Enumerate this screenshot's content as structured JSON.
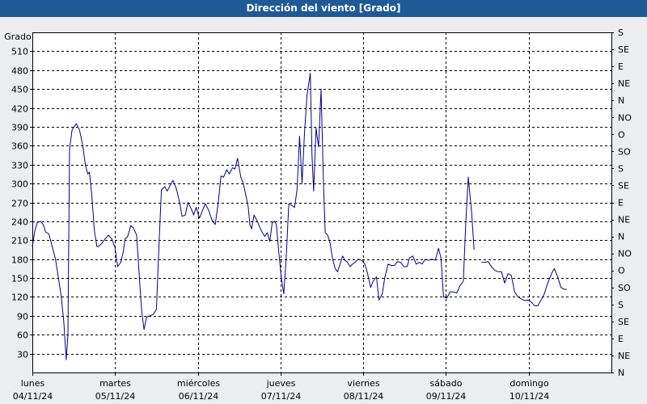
{
  "title": "Dirección del viento [Grado]",
  "chart_data": {
    "type": "line",
    "title": "Dirección del viento [Grado]",
    "ylabel": "Grado",
    "ylim": [
      0,
      540
    ],
    "yticks": [
      30,
      60,
      90,
      120,
      150,
      180,
      210,
      240,
      270,
      300,
      330,
      360,
      390,
      420,
      450,
      480,
      510
    ],
    "xlim": [
      0,
      7
    ],
    "xlabel": "",
    "x_ticks": [
      {
        "x": 0,
        "day": "lunes",
        "date": "04/11/24"
      },
      {
        "x": 1,
        "day": "martes",
        "date": "05/11/24"
      },
      {
        "x": 2,
        "day": "miércoles",
        "date": "06/11/24"
      },
      {
        "x": 3,
        "day": "jueves",
        "date": "07/11/24"
      },
      {
        "x": 4,
        "day": "viernes",
        "date": "08/11/24"
      },
      {
        "x": 5,
        "day": "sábado",
        "date": "09/11/24"
      },
      {
        "x": 6,
        "day": "domingo",
        "date": "10/11/24"
      }
    ],
    "right_axis": [
      {
        "value": 0,
        "label": "N"
      },
      {
        "value": 30,
        "label": "NE"
      },
      {
        "value": 60,
        "label": "E"
      },
      {
        "value": 90,
        "label": "SE"
      },
      {
        "value": 120,
        "label": "S"
      },
      {
        "value": 150,
        "label": "SO"
      },
      {
        "value": 180,
        "label": "O"
      },
      {
        "value": 210,
        "label": "NO"
      },
      {
        "value": 240,
        "label": "N"
      },
      {
        "value": 270,
        "label": "NE"
      },
      {
        "value": 300,
        "label": "E"
      },
      {
        "value": 330,
        "label": "SE"
      },
      {
        "value": 360,
        "label": "S"
      },
      {
        "value": 390,
        "label": "SO"
      },
      {
        "value": 420,
        "label": "O"
      },
      {
        "value": 450,
        "label": "NO"
      },
      {
        "value": 480,
        "label": "N"
      },
      {
        "value": 510,
        "label": "NE"
      },
      {
        "value": 540,
        "label": "E"
      },
      {
        "value": 570,
        "label": "SE"
      },
      {
        "value": 600,
        "label": "S"
      }
    ],
    "grid": true,
    "colors": {
      "line": "#00008b",
      "grid": "#000000",
      "background": "#ffffff",
      "titlebar": "#1f5a96"
    },
    "segments": [
      [
        [
          0.0,
          200
        ],
        [
          0.03,
          225
        ],
        [
          0.06,
          238
        ],
        [
          0.1,
          240
        ],
        [
          0.13,
          235
        ],
        [
          0.16,
          223
        ],
        [
          0.2,
          220
        ],
        [
          0.23,
          205
        ],
        [
          0.26,
          190
        ],
        [
          0.28,
          180
        ],
        [
          0.31,
          155
        ],
        [
          0.35,
          120
        ],
        [
          0.38,
          80
        ],
        [
          0.41,
          20
        ],
        [
          0.43,
          60
        ],
        [
          0.45,
          355
        ],
        [
          0.48,
          385
        ],
        [
          0.53,
          395
        ],
        [
          0.57,
          385
        ],
        [
          0.61,
          360
        ],
        [
          0.64,
          330
        ],
        [
          0.67,
          315
        ],
        [
          0.69,
          318
        ],
        [
          0.72,
          280
        ],
        [
          0.75,
          225
        ],
        [
          0.78,
          200
        ],
        [
          0.8,
          200
        ],
        [
          0.84,
          205
        ],
        [
          0.88,
          212
        ],
        [
          0.92,
          218
        ],
        [
          0.96,
          212
        ],
        [
          1.0,
          198
        ],
        [
          1.03,
          168
        ],
        [
          1.07,
          175
        ],
        [
          1.1,
          192
        ],
        [
          1.12,
          212
        ],
        [
          1.15,
          215
        ],
        [
          1.19,
          233
        ],
        [
          1.22,
          230
        ],
        [
          1.26,
          218
        ],
        [
          1.29,
          160
        ],
        [
          1.32,
          100
        ],
        [
          1.35,
          68
        ],
        [
          1.38,
          88
        ],
        [
          1.42,
          90
        ],
        [
          1.46,
          92
        ],
        [
          1.5,
          100
        ],
        [
          1.53,
          200
        ],
        [
          1.56,
          290
        ],
        [
          1.6,
          295
        ],
        [
          1.63,
          288
        ],
        [
          1.67,
          298
        ],
        [
          1.7,
          305
        ],
        [
          1.74,
          292
        ],
        [
          1.78,
          270
        ],
        [
          1.81,
          248
        ],
        [
          1.85,
          250
        ],
        [
          1.88,
          270
        ],
        [
          1.92,
          260
        ],
        [
          1.95,
          250
        ],
        [
          1.98,
          262
        ],
        [
          2.02,
          245
        ],
        [
          2.05,
          255
        ],
        [
          2.09,
          268
        ],
        [
          2.13,
          258
        ],
        [
          2.17,
          242
        ],
        [
          2.21,
          235
        ],
        [
          2.25,
          272
        ],
        [
          2.28,
          312
        ],
        [
          2.31,
          310
        ],
        [
          2.35,
          322
        ],
        [
          2.38,
          315
        ],
        [
          2.42,
          325
        ],
        [
          2.45,
          323
        ],
        [
          2.48,
          340
        ],
        [
          2.52,
          310
        ],
        [
          2.55,
          300
        ],
        [
          2.58,
          282
        ],
        [
          2.61,
          262
        ],
        [
          2.63,
          235
        ],
        [
          2.65,
          228
        ],
        [
          2.68,
          250
        ],
        [
          2.72,
          240
        ],
        [
          2.75,
          230
        ],
        [
          2.78,
          222
        ],
        [
          2.81,
          216
        ],
        [
          2.84,
          222
        ],
        [
          2.87,
          208
        ],
        [
          2.9,
          238
        ],
        [
          2.93,
          240
        ],
        [
          2.95,
          235
        ],
        [
          2.98,
          190
        ],
        [
          3.01,
          150
        ],
        [
          3.04,
          125
        ],
        [
          3.07,
          185
        ],
        [
          3.1,
          268
        ],
        [
          3.14,
          265
        ],
        [
          3.17,
          262
        ],
        [
          3.2,
          290
        ],
        [
          3.23,
          375
        ],
        [
          3.26,
          300
        ],
        [
          3.29,
          380
        ],
        [
          3.32,
          440
        ],
        [
          3.36,
          475
        ],
        [
          3.38,
          348
        ],
        [
          3.4,
          288
        ],
        [
          3.43,
          388
        ],
        [
          3.46,
          358
        ],
        [
          3.49,
          450
        ],
        [
          3.52,
          300
        ],
        [
          3.54,
          222
        ],
        [
          3.57,
          218
        ],
        [
          3.6,
          205
        ],
        [
          3.63,
          180
        ],
        [
          3.66,
          165
        ],
        [
          3.69,
          160
        ],
        [
          3.72,
          172
        ],
        [
          3.75,
          185
        ],
        [
          3.78,
          178
        ],
        [
          3.81,
          175
        ],
        [
          3.84,
          168
        ],
        [
          3.87,
          172
        ],
        [
          3.9,
          175
        ],
        [
          3.94,
          180
        ],
        [
          3.98,
          178
        ],
        [
          4.02,
          172
        ],
        [
          4.05,
          158
        ],
        [
          4.09,
          135
        ],
        [
          4.12,
          145
        ],
        [
          4.16,
          152
        ],
        [
          4.19,
          115
        ],
        [
          4.23,
          125
        ],
        [
          4.26,
          150
        ],
        [
          4.3,
          172
        ],
        [
          4.34,
          170
        ],
        [
          4.38,
          170
        ],
        [
          4.41,
          176
        ],
        [
          4.45,
          175
        ],
        [
          4.49,
          168
        ],
        [
          4.53,
          168
        ],
        [
          4.56,
          182
        ],
        [
          4.6,
          185
        ],
        [
          4.64,
          172
        ],
        [
          4.68,
          175
        ],
        [
          4.71,
          172
        ],
        [
          4.75,
          180
        ],
        [
          4.79,
          178
        ],
        [
          4.83,
          180
        ],
        [
          4.87,
          178
        ],
        [
          4.91,
          197
        ],
        [
          4.94,
          182
        ],
        [
          4.97,
          120
        ],
        [
          5.01,
          118
        ],
        [
          5.05,
          128
        ],
        [
          5.09,
          128
        ],
        [
          5.13,
          126
        ],
        [
          5.17,
          138
        ],
        [
          5.21,
          145
        ],
        [
          5.24,
          240
        ],
        [
          5.27,
          310
        ],
        [
          5.31,
          255
        ],
        [
          5.34,
          195
        ]
      ],
      [
        [
          5.43,
          175
        ],
        [
          5.47,
          175
        ],
        [
          5.51,
          176
        ],
        [
          5.55,
          168
        ],
        [
          5.59,
          162
        ],
        [
          5.63,
          160
        ],
        [
          5.67,
          160
        ],
        [
          5.71,
          142
        ],
        [
          5.75,
          157
        ],
        [
          5.79,
          154
        ],
        [
          5.83,
          128
        ],
        [
          5.87,
          120
        ],
        [
          5.91,
          117
        ],
        [
          5.95,
          114
        ],
        [
          5.99,
          115
        ],
        [
          6.03,
          112
        ],
        [
          6.07,
          106
        ],
        [
          6.11,
          106
        ],
        [
          6.15,
          115
        ],
        [
          6.19,
          125
        ],
        [
          6.23,
          142
        ],
        [
          6.28,
          158
        ],
        [
          6.31,
          165
        ],
        [
          6.35,
          152
        ],
        [
          6.39,
          135
        ],
        [
          6.43,
          132
        ],
        [
          6.46,
          132
        ]
      ]
    ]
  }
}
